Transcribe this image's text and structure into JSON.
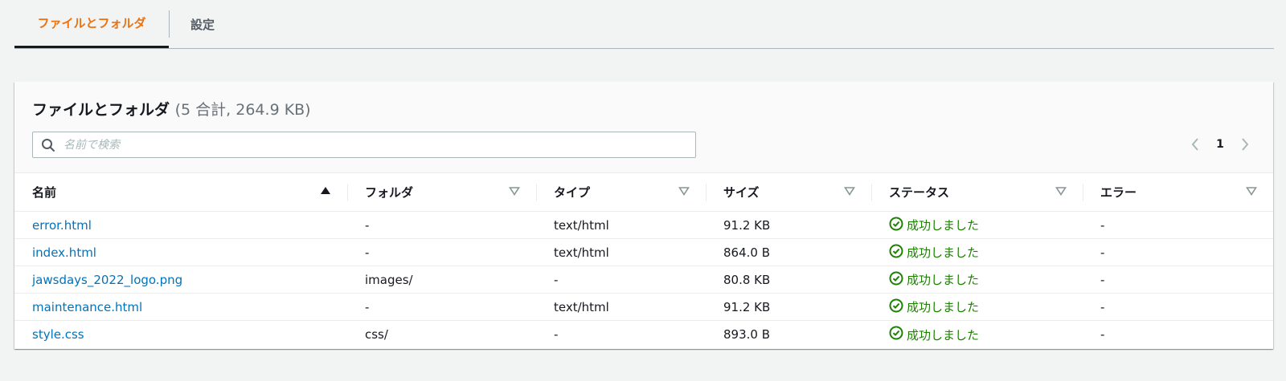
{
  "tabs": [
    {
      "label": "ファイルとフォルダ"
    },
    {
      "label": "設定"
    }
  ],
  "panel": {
    "title": "ファイルとフォルダ",
    "counter": "(5 合計, 264.9 KB)"
  },
  "search": {
    "placeholder": "名前で検索"
  },
  "pagination": {
    "current_page": "1"
  },
  "table": {
    "columns": [
      "名前",
      "フォルダ",
      "タイプ",
      "サイズ",
      "ステータス",
      "エラー"
    ],
    "rows": [
      {
        "name": "error.html",
        "folder": "-",
        "type": "text/html",
        "size": "91.2 KB",
        "status": "成功しました",
        "error": "-"
      },
      {
        "name": "index.html",
        "folder": "-",
        "type": "text/html",
        "size": "864.0 B",
        "status": "成功しました",
        "error": "-"
      },
      {
        "name": "jawsdays_2022_logo.png",
        "folder": "images/",
        "type": "-",
        "size": "80.8 KB",
        "status": "成功しました",
        "error": "-"
      },
      {
        "name": "maintenance.html",
        "folder": "-",
        "type": "text/html",
        "size": "91.2 KB",
        "status": "成功しました",
        "error": "-"
      },
      {
        "name": "style.css",
        "folder": "css/",
        "type": "-",
        "size": "893.0 B",
        "status": "成功しました",
        "error": "-"
      }
    ]
  },
  "icons": {
    "search": "search-icon",
    "prev": "chevron-left-icon",
    "next": "chevron-right-icon",
    "sort_asc": "sort-ascending-icon",
    "sort_none": "sort-descending-outline-icon",
    "status_ok": "check-circle-icon"
  },
  "colors": {
    "accent": "#ec7211",
    "link": "#0073bb",
    "success": "#1d8102",
    "background": "#f2f3f3"
  }
}
